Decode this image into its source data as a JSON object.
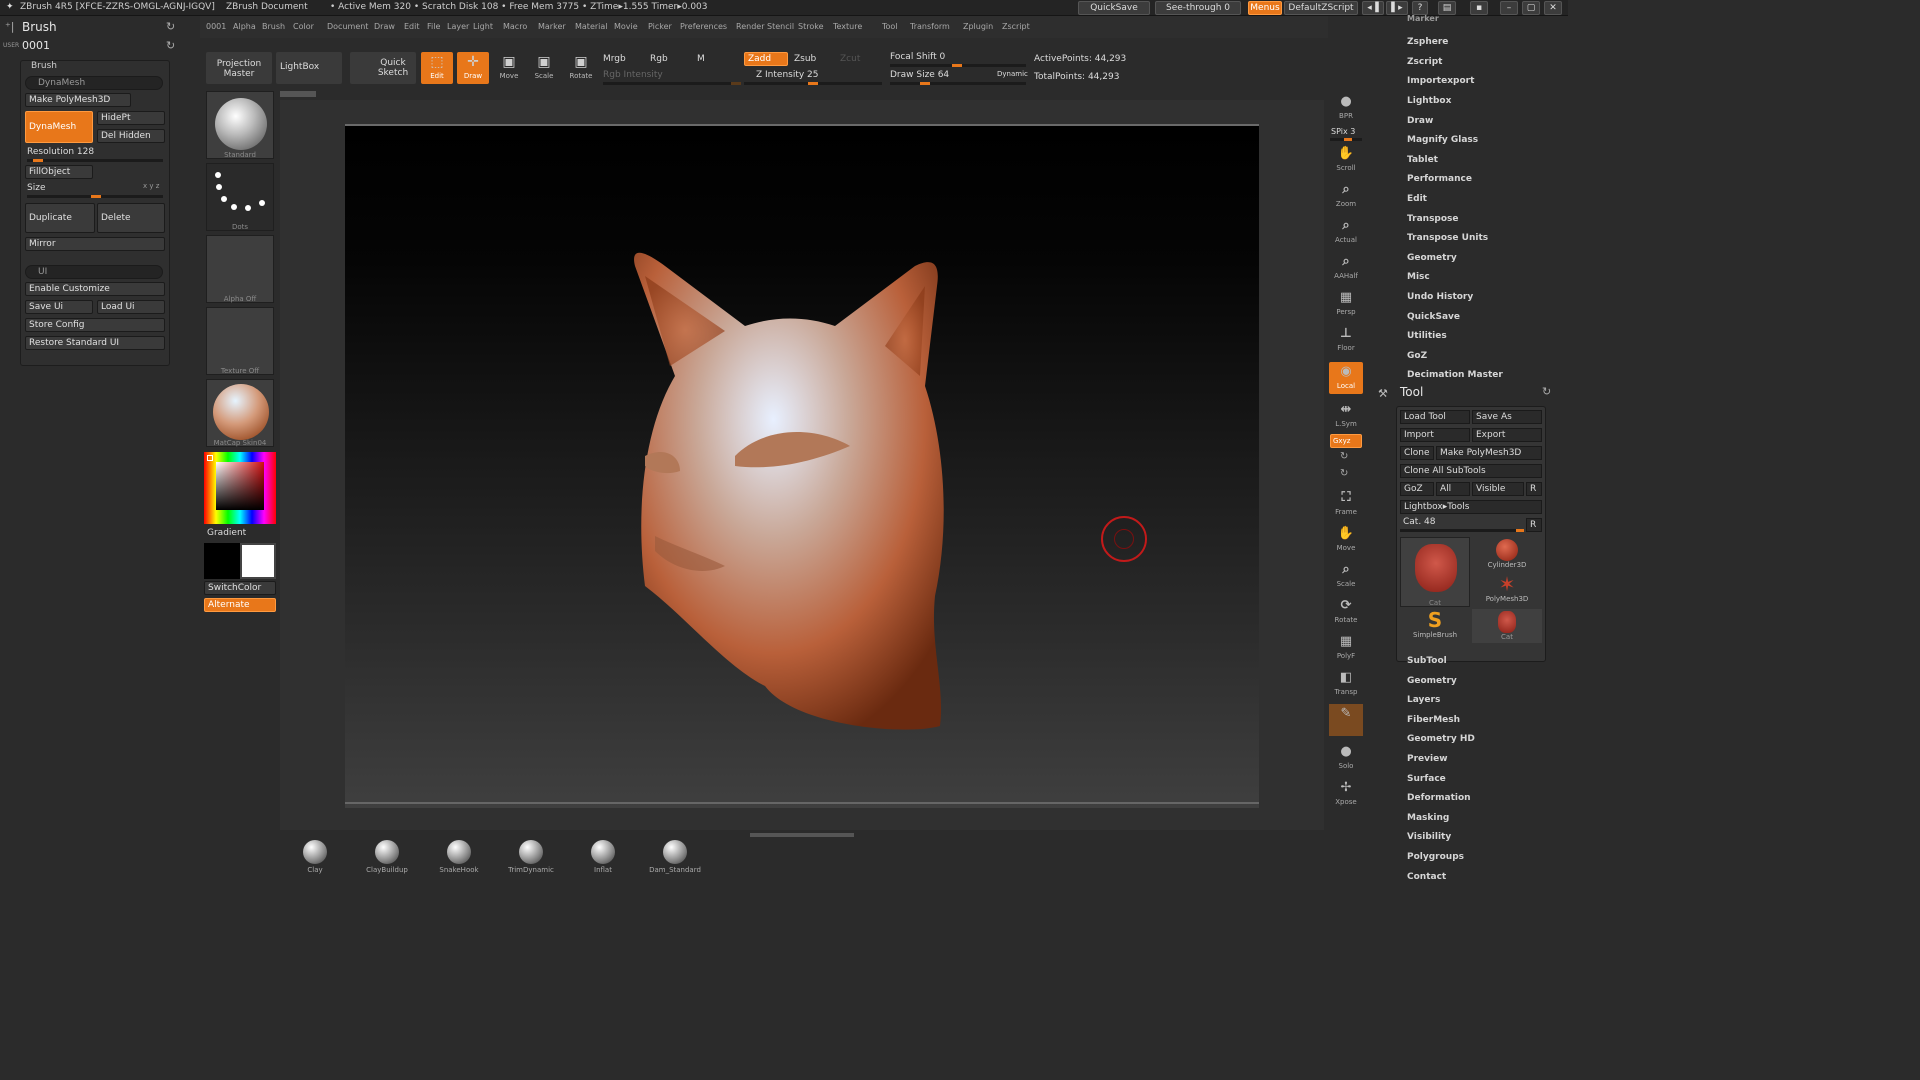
{
  "titlebar": {
    "app": "ZBrush 4R5 [XFCE-ZZRS-OMGL-AGNJ-IGQV]",
    "doc": "ZBrush Document",
    "mem": "• Active Mem 320 • Scratch Disk 108 • Free Mem 3775 • ZTime▸1.555 Timer▸0.003",
    "quicksave": "QuickSave",
    "seethrough": "See-through 0",
    "menus": "Menus",
    "script": "DefaultZScript"
  },
  "menubar": [
    "0001",
    "Alpha",
    "Brush",
    "Color",
    "Document",
    "Draw",
    "Edit",
    "File",
    "Layer",
    "Light",
    "Macro",
    "Marker",
    "Material",
    "Movie",
    "Picker",
    "Preferences",
    "Render",
    "Stencil",
    "Stroke",
    "Texture",
    "Tool",
    "Transform",
    "Zplugin",
    "Zscript"
  ],
  "left": {
    "title": "Brush",
    "user": "USER",
    "counter": "0001",
    "brush_header": "Brush",
    "dynamesh_pill": "DynaMesh",
    "make_polymesh": "Make PolyMesh3D",
    "dynamesh": "DynaMesh",
    "hidept": "HidePt",
    "delhidden": "Del Hidden",
    "resolution": "Resolution 128",
    "fillobject": "FillObject",
    "size": "Size",
    "duplicate": "Duplicate",
    "delete": "Delete",
    "mirror": "Mirror",
    "ui_pill": "UI",
    "enable_customize": "Enable Customize",
    "save_ui": "Save Ui",
    "load_ui": "Load Ui",
    "store_config": "Store Config",
    "restore_ui": "Restore Standard UI"
  },
  "topbar": {
    "projection_master": "Projection Master",
    "lightbox": "LightBox",
    "quick_sketch": "Quick Sketch",
    "edit": "Edit",
    "draw": "Draw",
    "move": "Move",
    "scale": "Scale",
    "rotate": "Rotate",
    "mrgb": "Mrgb",
    "rgb": "Rgb",
    "m": "M",
    "rgb_intensity": "Rgb Intensity",
    "zadd": "Zadd",
    "zsub": "Zsub",
    "zcut": "Zcut",
    "z_intensity": "Z Intensity 25",
    "focal_shift": "Focal Shift 0",
    "draw_size": "Draw Size 64",
    "dynamic": "Dynamic",
    "active_points": "ActivePoints: 44,293",
    "total_points": "TotalPoints: 44,293"
  },
  "shelf_left": {
    "standard": "Standard",
    "dots": "Dots",
    "alpha": "Alpha Off",
    "texture": "Texture Off",
    "matcap": "MatCap Skin04",
    "gradient": "Gradient",
    "switchcolor": "SwitchColor",
    "alternate": "Alternate"
  },
  "shelf_right": {
    "bpr": "BPR",
    "spix": "SPix 3",
    "scroll": "Scroll",
    "zoom": "Zoom",
    "actual": "Actual",
    "aahalf": "AAHalf",
    "persp": "Persp",
    "floor": "Floor",
    "local": "Local",
    "lsym": "L.Sym",
    "xyz": "Gxyz",
    "frame": "Frame",
    "move": "Move",
    "scale": "Scale",
    "rotate": "Rotate",
    "polyf": "PolyF",
    "transp": "Transp",
    "solo": "Solo",
    "xpose": "Xpose"
  },
  "bottom_brushes": [
    "Clay",
    "ClayBuildup",
    "SnakeHook",
    "TrimDynamic",
    "Inflat",
    "Dam_Standard"
  ],
  "right_menu": [
    "Marker",
    "Zsphere",
    "Zscript",
    "Importexport",
    "Lightbox",
    "Draw",
    "Magnify Glass",
    "Tablet",
    "Performance",
    "Edit",
    "Transpose",
    "Transpose Units",
    "Geometry",
    "Misc",
    "Undo History",
    "QuickSave",
    "Utilities",
    "GoZ",
    "Decimation Master"
  ],
  "tool_panel": {
    "title": "Tool",
    "load_tool": "Load Tool",
    "save_as": "Save As",
    "import": "Import",
    "export": "Export",
    "clone": "Clone",
    "make_polymesh": "Make PolyMesh3D",
    "clone_all": "Clone All SubTools",
    "goz": "GoZ",
    "all": "All",
    "visible": "Visible",
    "r": "R",
    "lightbox_tools": "Lightbox▸Tools",
    "cat48": "Cat. 48",
    "cat": "Cat",
    "cylinder": "Cylinder3D",
    "polymesh": "PolyMesh3D",
    "simplebrush": "SimpleBrush",
    "cat2": "Cat"
  },
  "tool_sub_menu": [
    "SubTool",
    "Geometry",
    "Layers",
    "FiberMesh",
    "Geometry HD",
    "Preview",
    "Surface",
    "Deformation",
    "Masking",
    "Visibility",
    "Polygroups",
    "Contact"
  ],
  "colors": {
    "accent": "#e8771a"
  }
}
